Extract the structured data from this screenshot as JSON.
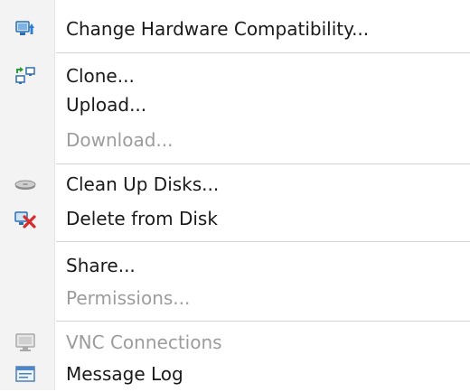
{
  "context_menu": {
    "items": [
      {
        "label": "Change Hardware Compatibility...",
        "icon": "upgrade-hardware-icon",
        "enabled": true
      },
      {
        "label": "Clone...",
        "icon": "clone-icon",
        "enabled": true
      },
      {
        "label": "Upload...",
        "icon": "",
        "enabled": true
      },
      {
        "label": "Download...",
        "icon": "",
        "enabled": false
      },
      {
        "label": "Clean Up Disks...",
        "icon": "disk-cleanup-icon",
        "enabled": true
      },
      {
        "label": "Delete from Disk",
        "icon": "delete-from-disk-icon",
        "enabled": true
      },
      {
        "label": "Share...",
        "icon": "",
        "enabled": true
      },
      {
        "label": "Permissions...",
        "icon": "",
        "enabled": false
      },
      {
        "label": "VNC Connections",
        "icon": "vnc-monitor-icon",
        "enabled": false
      },
      {
        "label": "Message Log",
        "icon": "message-log-icon",
        "enabled": true
      }
    ]
  },
  "colors": {
    "text": "#1a1a1a",
    "disabled_text": "#9c9c9c",
    "gutter": "#f3f3f3",
    "separator": "#d2d2d2",
    "accent_blue": "#2f7fd0",
    "delete_red": "#d82c2c"
  }
}
